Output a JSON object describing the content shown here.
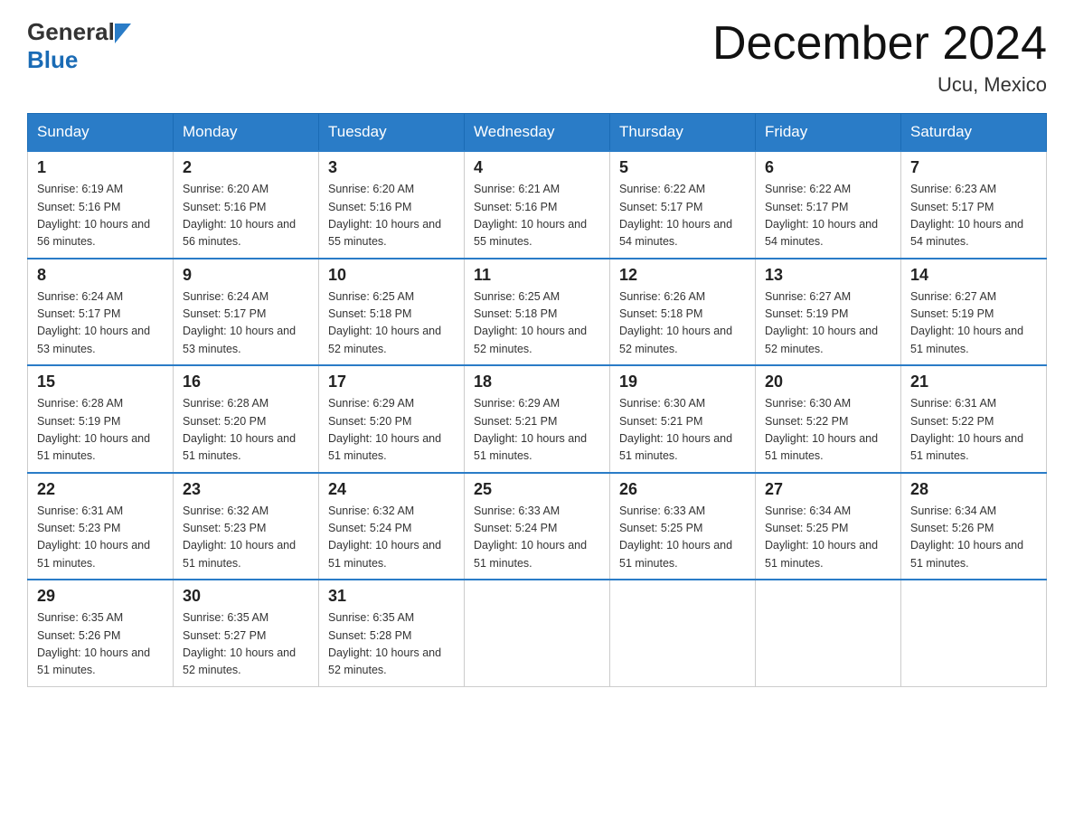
{
  "header": {
    "logo_general": "General",
    "logo_blue": "Blue",
    "month_title": "December 2024",
    "location": "Ucu, Mexico"
  },
  "days_of_week": [
    "Sunday",
    "Monday",
    "Tuesday",
    "Wednesday",
    "Thursday",
    "Friday",
    "Saturday"
  ],
  "weeks": [
    [
      {
        "day": "1",
        "sunrise": "6:19 AM",
        "sunset": "5:16 PM",
        "daylight": "10 hours and 56 minutes."
      },
      {
        "day": "2",
        "sunrise": "6:20 AM",
        "sunset": "5:16 PM",
        "daylight": "10 hours and 56 minutes."
      },
      {
        "day": "3",
        "sunrise": "6:20 AM",
        "sunset": "5:16 PM",
        "daylight": "10 hours and 55 minutes."
      },
      {
        "day": "4",
        "sunrise": "6:21 AM",
        "sunset": "5:16 PM",
        "daylight": "10 hours and 55 minutes."
      },
      {
        "day": "5",
        "sunrise": "6:22 AM",
        "sunset": "5:17 PM",
        "daylight": "10 hours and 54 minutes."
      },
      {
        "day": "6",
        "sunrise": "6:22 AM",
        "sunset": "5:17 PM",
        "daylight": "10 hours and 54 minutes."
      },
      {
        "day": "7",
        "sunrise": "6:23 AM",
        "sunset": "5:17 PM",
        "daylight": "10 hours and 54 minutes."
      }
    ],
    [
      {
        "day": "8",
        "sunrise": "6:24 AM",
        "sunset": "5:17 PM",
        "daylight": "10 hours and 53 minutes."
      },
      {
        "day": "9",
        "sunrise": "6:24 AM",
        "sunset": "5:17 PM",
        "daylight": "10 hours and 53 minutes."
      },
      {
        "day": "10",
        "sunrise": "6:25 AM",
        "sunset": "5:18 PM",
        "daylight": "10 hours and 52 minutes."
      },
      {
        "day": "11",
        "sunrise": "6:25 AM",
        "sunset": "5:18 PM",
        "daylight": "10 hours and 52 minutes."
      },
      {
        "day": "12",
        "sunrise": "6:26 AM",
        "sunset": "5:18 PM",
        "daylight": "10 hours and 52 minutes."
      },
      {
        "day": "13",
        "sunrise": "6:27 AM",
        "sunset": "5:19 PM",
        "daylight": "10 hours and 52 minutes."
      },
      {
        "day": "14",
        "sunrise": "6:27 AM",
        "sunset": "5:19 PM",
        "daylight": "10 hours and 51 minutes."
      }
    ],
    [
      {
        "day": "15",
        "sunrise": "6:28 AM",
        "sunset": "5:19 PM",
        "daylight": "10 hours and 51 minutes."
      },
      {
        "day": "16",
        "sunrise": "6:28 AM",
        "sunset": "5:20 PM",
        "daylight": "10 hours and 51 minutes."
      },
      {
        "day": "17",
        "sunrise": "6:29 AM",
        "sunset": "5:20 PM",
        "daylight": "10 hours and 51 minutes."
      },
      {
        "day": "18",
        "sunrise": "6:29 AM",
        "sunset": "5:21 PM",
        "daylight": "10 hours and 51 minutes."
      },
      {
        "day": "19",
        "sunrise": "6:30 AM",
        "sunset": "5:21 PM",
        "daylight": "10 hours and 51 minutes."
      },
      {
        "day": "20",
        "sunrise": "6:30 AM",
        "sunset": "5:22 PM",
        "daylight": "10 hours and 51 minutes."
      },
      {
        "day": "21",
        "sunrise": "6:31 AM",
        "sunset": "5:22 PM",
        "daylight": "10 hours and 51 minutes."
      }
    ],
    [
      {
        "day": "22",
        "sunrise": "6:31 AM",
        "sunset": "5:23 PM",
        "daylight": "10 hours and 51 minutes."
      },
      {
        "day": "23",
        "sunrise": "6:32 AM",
        "sunset": "5:23 PM",
        "daylight": "10 hours and 51 minutes."
      },
      {
        "day": "24",
        "sunrise": "6:32 AM",
        "sunset": "5:24 PM",
        "daylight": "10 hours and 51 minutes."
      },
      {
        "day": "25",
        "sunrise": "6:33 AM",
        "sunset": "5:24 PM",
        "daylight": "10 hours and 51 minutes."
      },
      {
        "day": "26",
        "sunrise": "6:33 AM",
        "sunset": "5:25 PM",
        "daylight": "10 hours and 51 minutes."
      },
      {
        "day": "27",
        "sunrise": "6:34 AM",
        "sunset": "5:25 PM",
        "daylight": "10 hours and 51 minutes."
      },
      {
        "day": "28",
        "sunrise": "6:34 AM",
        "sunset": "5:26 PM",
        "daylight": "10 hours and 51 minutes."
      }
    ],
    [
      {
        "day": "29",
        "sunrise": "6:35 AM",
        "sunset": "5:26 PM",
        "daylight": "10 hours and 51 minutes."
      },
      {
        "day": "30",
        "sunrise": "6:35 AM",
        "sunset": "5:27 PM",
        "daylight": "10 hours and 52 minutes."
      },
      {
        "day": "31",
        "sunrise": "6:35 AM",
        "sunset": "5:28 PM",
        "daylight": "10 hours and 52 minutes."
      },
      null,
      null,
      null,
      null
    ]
  ],
  "labels": {
    "sunrise_prefix": "Sunrise: ",
    "sunset_prefix": "Sunset: ",
    "daylight_prefix": "Daylight: "
  }
}
